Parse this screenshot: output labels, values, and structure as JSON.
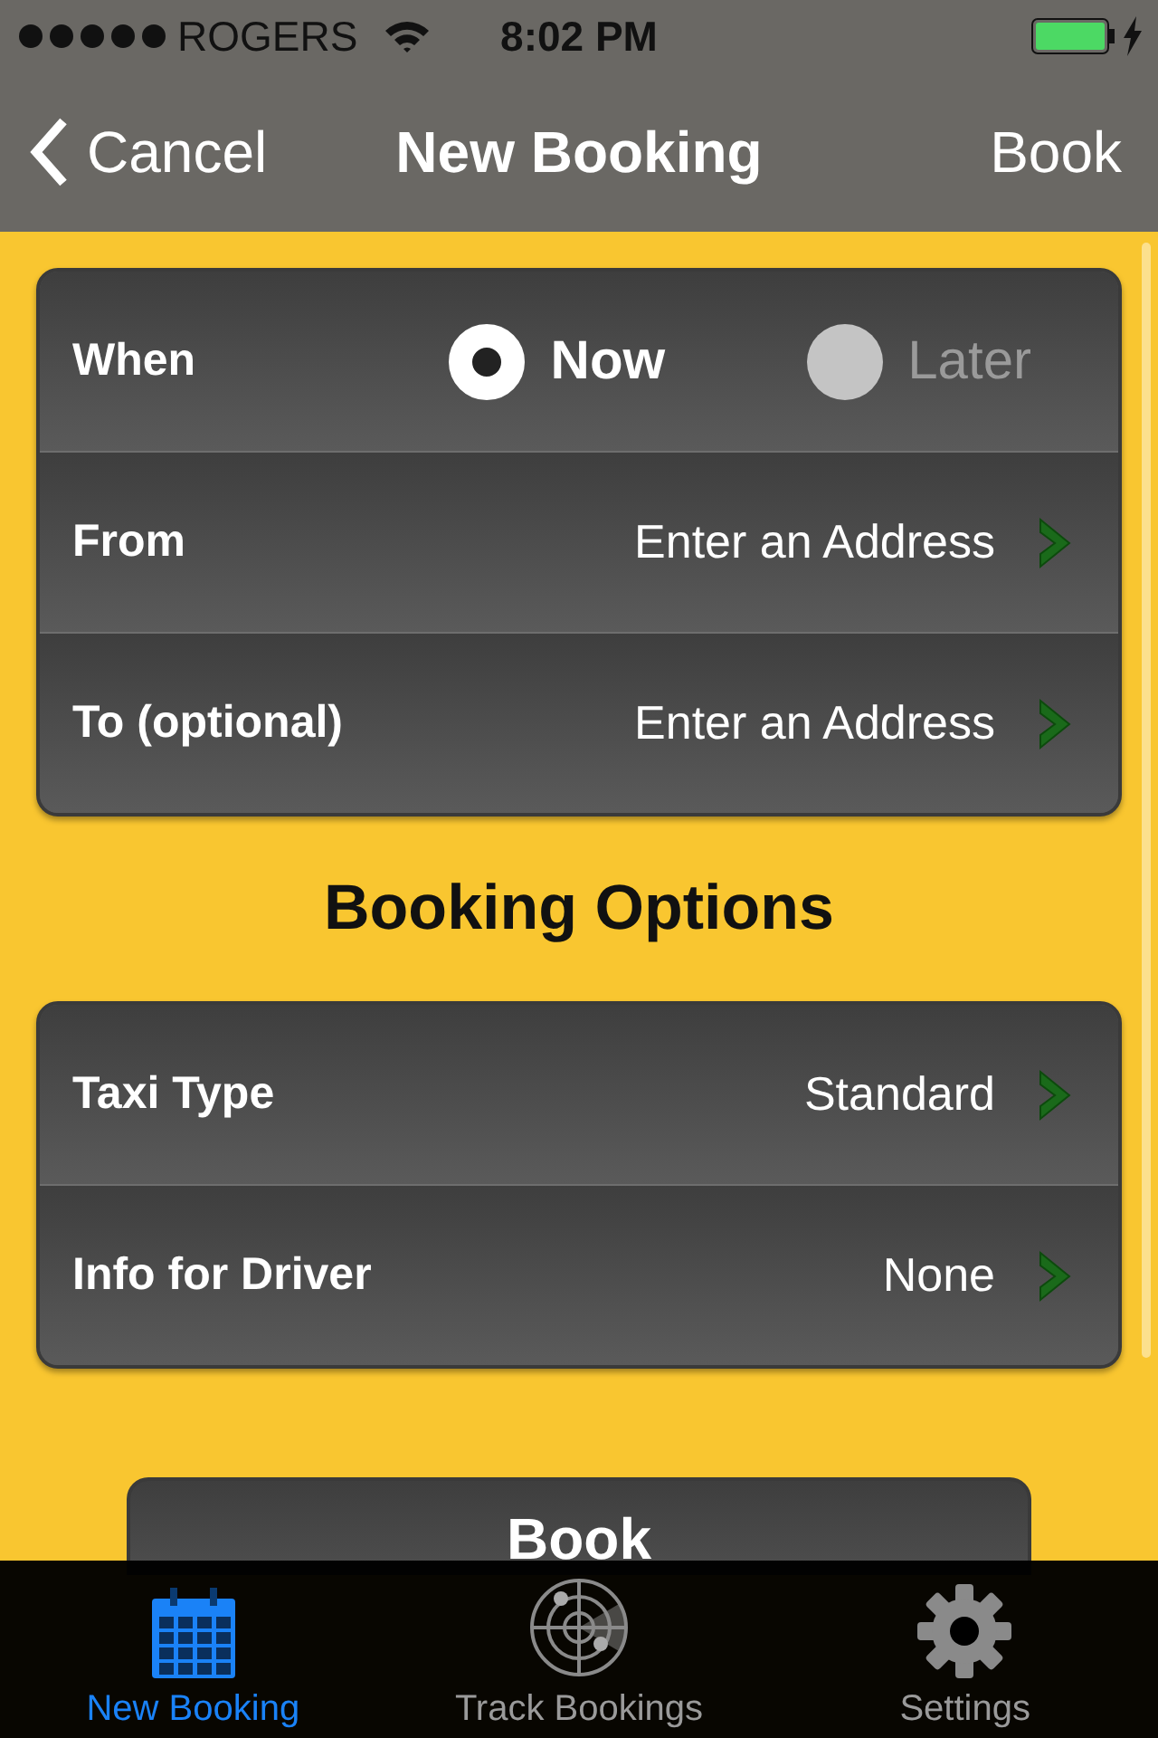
{
  "status_bar": {
    "carrier": "ROGERS",
    "time": "8:02 PM",
    "charging": true
  },
  "nav_bar": {
    "back": "Cancel",
    "title": "New Booking",
    "action": "Book"
  },
  "trip": {
    "when": {
      "label": "When",
      "options": [
        {
          "label": "Now",
          "selected": true
        },
        {
          "label": "Later",
          "selected": false
        }
      ]
    },
    "rows": [
      {
        "label": "From",
        "value": "Enter an Address"
      },
      {
        "label": "To (optional)",
        "value": "Enter an Address"
      }
    ]
  },
  "options_heading": "Booking Options",
  "options": [
    {
      "label": "Taxi Type",
      "value": "Standard"
    },
    {
      "label": "Info for Driver",
      "value": "None"
    }
  ],
  "book_button": "Book",
  "tabs": [
    {
      "label": "New Booking",
      "kind": "calendar",
      "selected": true
    },
    {
      "label": "Track Bookings",
      "kind": "radar",
      "selected": false
    },
    {
      "label": "Settings",
      "kind": "gear",
      "selected": false
    }
  ]
}
